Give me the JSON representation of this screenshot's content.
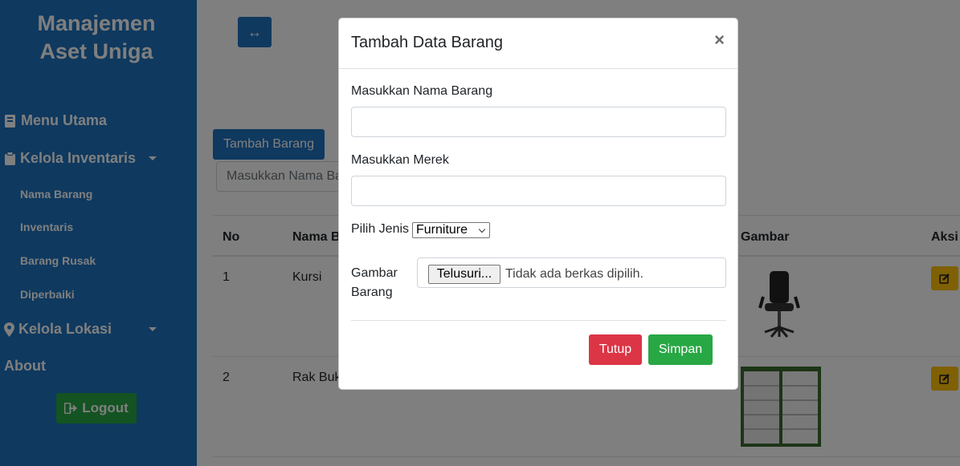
{
  "sidebar": {
    "brand_line1": "Manajemen",
    "brand_line2": "Aset Uniga",
    "menu_utama": "Menu Utama",
    "kelola_inventaris": "Kelola Inventaris",
    "sub_items": [
      "Nama Barang",
      "Inventaris",
      "Barang Rusak",
      "Diperbaiki"
    ],
    "kelola_lokasi": "Kelola Lokasi",
    "about": "About",
    "logout": "Logout"
  },
  "main": {
    "add_button": "Tambah Barang",
    "search_placeholder": "Masukkan Nama Barang",
    "table": {
      "headers": {
        "no": "No",
        "nama": "Nama Barang",
        "gambar": "Gambar",
        "aksi": "Aksi"
      },
      "rows": [
        {
          "no": "1",
          "nama": "Kursi"
        },
        {
          "no": "2",
          "nama": "Rak Buku"
        }
      ]
    }
  },
  "modal": {
    "title": "Tambah Data Barang",
    "close_symbol": "×",
    "nama_label": "Masukkan Nama Barang",
    "merek_label": "Masukkan Merek",
    "jenis_label": "Pilih Jenis",
    "jenis_value": "Furniture",
    "gambar_label_1": "Gambar",
    "gambar_label_2": "Barang",
    "file_button": "Telusuri...",
    "file_status": "Tidak ada berkas dipilih.",
    "btn_close": "Tutup",
    "btn_save": "Simpan"
  },
  "colors": {
    "primary": "#1e73be",
    "success": "#28a745",
    "danger": "#dc3545",
    "warning": "#ffc107"
  }
}
